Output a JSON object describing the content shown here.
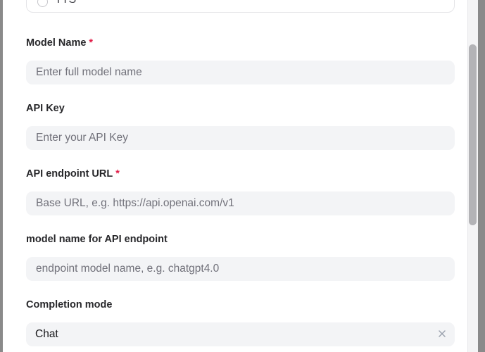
{
  "options": {
    "tts_label": "TTS"
  },
  "fields": {
    "model_name": {
      "label": "Model Name",
      "required_mark": "*",
      "placeholder": "Enter full model name"
    },
    "api_key": {
      "label": "API Key",
      "placeholder": "Enter your API Key"
    },
    "api_endpoint_url": {
      "label": "API endpoint URL",
      "required_mark": "*",
      "placeholder": "Base URL, e.g. https://api.openai.com/v1"
    },
    "endpoint_model_name": {
      "label": "model name for API endpoint",
      "placeholder": "endpoint model name, e.g. chatgpt4.0"
    },
    "completion_mode": {
      "label": "Completion mode",
      "value": "Chat",
      "clear_icon": "close-icon"
    }
  },
  "colors": {
    "required": "#e11d48",
    "input_bg": "#f3f4f6",
    "label": "#27272a",
    "placeholder": "#71717a"
  }
}
